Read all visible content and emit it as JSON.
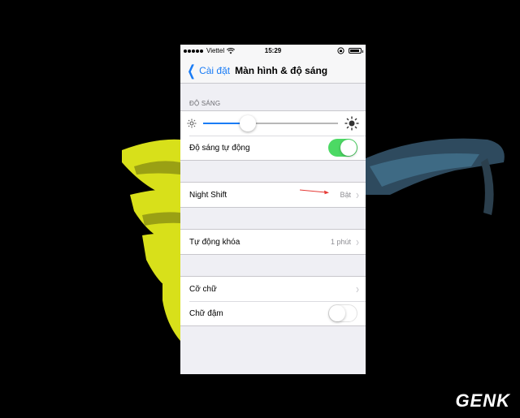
{
  "status_bar": {
    "carrier": "Viettel",
    "time": "15:29",
    "battery_level": 0.9
  },
  "nav": {
    "back_label": "Cài đặt",
    "title": "Màn hình & độ sáng"
  },
  "brightness": {
    "section_header": "ĐỘ SÁNG",
    "slider_value": 0.33,
    "auto_label": "Độ sáng tự động",
    "auto_on": true
  },
  "night_shift": {
    "label": "Night Shift",
    "value": "Bật"
  },
  "auto_lock": {
    "label": "Tự động khóa",
    "value": "1 phút"
  },
  "text": {
    "text_size_label": "Cỡ chữ",
    "bold_text_label": "Chữ đậm",
    "bold_text_on": false
  },
  "watermark": "GENK",
  "colors": {
    "accent": "#1a7cf5",
    "toggle_on": "#4cd964",
    "arrow": "#e53935"
  }
}
